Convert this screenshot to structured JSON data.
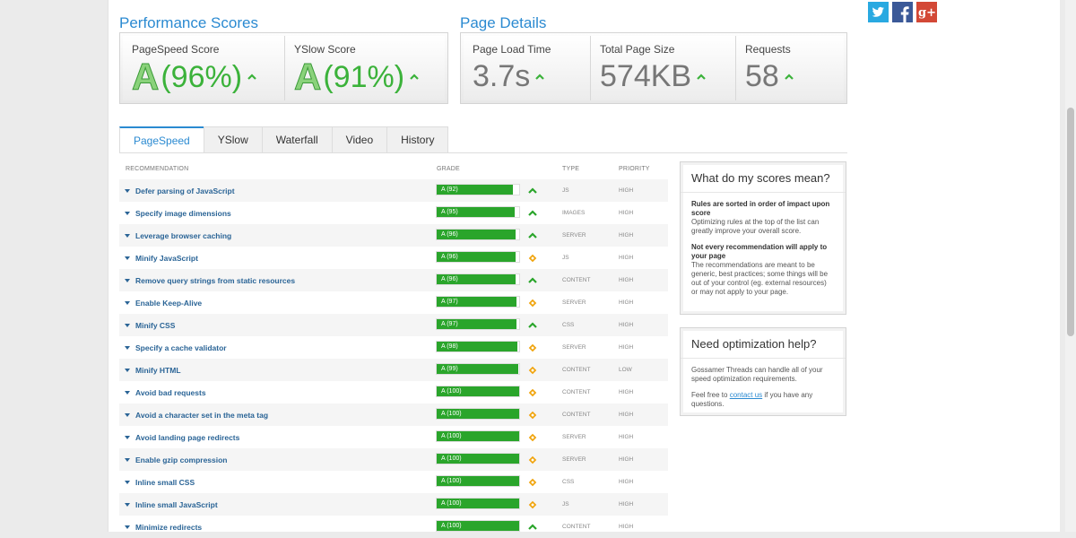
{
  "performance": {
    "title": "Performance Scores",
    "pagespeed_label": "PageSpeed Score",
    "pagespeed_grade": "A",
    "pagespeed_pct": "(96%)",
    "yslow_label": "YSlow Score",
    "yslow_grade": "A",
    "yslow_pct": "(91%)"
  },
  "details": {
    "title": "Page Details",
    "load_time_label": "Page Load Time",
    "load_time": "3.7s",
    "page_size_label": "Total Page Size",
    "page_size": "574KB",
    "requests_label": "Requests",
    "requests": "58"
  },
  "tabs": [
    "PageSpeed",
    "YSlow",
    "Waterfall",
    "Video",
    "History"
  ],
  "table": {
    "headers": {
      "recommendation": "RECOMMENDATION",
      "grade": "GRADE",
      "type": "TYPE",
      "priority": "PRIORITY"
    },
    "rows": [
      {
        "rec": "Defer parsing of JavaScript",
        "grade": "A (92)",
        "score": 92,
        "trend": "up",
        "type": "JS",
        "priority": "HIGH"
      },
      {
        "rec": "Specify image dimensions",
        "grade": "A (95)",
        "score": 95,
        "trend": "up",
        "type": "IMAGES",
        "priority": "HIGH"
      },
      {
        "rec": "Leverage browser caching",
        "grade": "A (96)",
        "score": 96,
        "trend": "up",
        "type": "SERVER",
        "priority": "HIGH"
      },
      {
        "rec": "Minify JavaScript",
        "grade": "A (96)",
        "score": 96,
        "trend": "same",
        "type": "JS",
        "priority": "HIGH"
      },
      {
        "rec": "Remove query strings from static resources",
        "grade": "A (96)",
        "score": 96,
        "trend": "up",
        "type": "CONTENT",
        "priority": "HIGH"
      },
      {
        "rec": "Enable Keep-Alive",
        "grade": "A (97)",
        "score": 97,
        "trend": "same",
        "type": "SERVER",
        "priority": "HIGH"
      },
      {
        "rec": "Minify CSS",
        "grade": "A (97)",
        "score": 97,
        "trend": "up",
        "type": "CSS",
        "priority": "HIGH"
      },
      {
        "rec": "Specify a cache validator",
        "grade": "A (98)",
        "score": 98,
        "trend": "same",
        "type": "SERVER",
        "priority": "HIGH"
      },
      {
        "rec": "Minify HTML",
        "grade": "A (99)",
        "score": 99,
        "trend": "same",
        "type": "CONTENT",
        "priority": "LOW"
      },
      {
        "rec": "Avoid bad requests",
        "grade": "A (100)",
        "score": 100,
        "trend": "same",
        "type": "CONTENT",
        "priority": "HIGH"
      },
      {
        "rec": "Avoid a character set in the meta tag",
        "grade": "A (100)",
        "score": 100,
        "trend": "same",
        "type": "CONTENT",
        "priority": "HIGH"
      },
      {
        "rec": "Avoid landing page redirects",
        "grade": "A (100)",
        "score": 100,
        "trend": "same",
        "type": "SERVER",
        "priority": "HIGH"
      },
      {
        "rec": "Enable gzip compression",
        "grade": "A (100)",
        "score": 100,
        "trend": "same",
        "type": "SERVER",
        "priority": "HIGH"
      },
      {
        "rec": "Inline small CSS",
        "grade": "A (100)",
        "score": 100,
        "trend": "same",
        "type": "CSS",
        "priority": "HIGH"
      },
      {
        "rec": "Inline small JavaScript",
        "grade": "A (100)",
        "score": 100,
        "trend": "same",
        "type": "JS",
        "priority": "HIGH"
      },
      {
        "rec": "Minimize redirects",
        "grade": "A (100)",
        "score": 100,
        "trend": "up",
        "type": "CONTENT",
        "priority": "HIGH"
      }
    ]
  },
  "scores_box": {
    "title": "What do my scores mean?",
    "p1_bold": "Rules are sorted in order of impact upon score",
    "p1_text": "Optimizing rules at the top of the list can greatly improve your overall score.",
    "p2_bold": "Not every recommendation will apply to your page",
    "p2_text": "The recommendations are meant to be generic, best practices; some things will be out of your control (eg. external resources) or may not apply to your page."
  },
  "help_box": {
    "title": "Need optimization help?",
    "p1": "Gossamer Threads can handle all of your speed optimization requirements.",
    "p2_before": "Feel free to",
    "p2_link": "contact us",
    "p2_after": "if you have any questions."
  },
  "social": {
    "twitter": "twitter-icon",
    "facebook": "facebook-icon",
    "google_plus": "google-plus-icon"
  },
  "colors": {
    "accent": "#2b8ad1",
    "grade_green": "#2aa52b",
    "same_orange": "#f0a30a"
  }
}
